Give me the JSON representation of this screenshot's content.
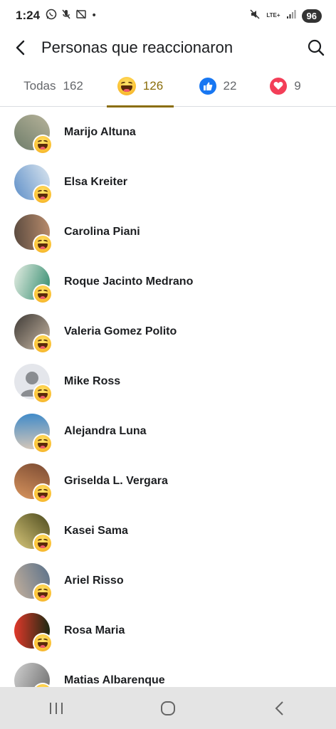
{
  "status_bar": {
    "time": "1:24",
    "dot": "•",
    "network": "LTE+",
    "battery": "96"
  },
  "header": {
    "title": "Personas que reaccionaron"
  },
  "tabs": [
    {
      "label": "Todas",
      "count": "162"
    },
    {
      "label": "",
      "count": "126",
      "icon": "haha-emoji-icon"
    },
    {
      "label": "",
      "count": "22",
      "icon": "like-icon"
    },
    {
      "label": "",
      "count": "9",
      "icon": "love-icon"
    }
  ],
  "people": [
    {
      "name": "Marijo Altuna",
      "reaction": "haha",
      "avatar_colors": [
        "#6e7d6a",
        "#b7b39a"
      ]
    },
    {
      "name": "Elsa Kreiter",
      "reaction": "haha",
      "avatar_colors": [
        "#5e8fc8",
        "#dbe6ef"
      ]
    },
    {
      "name": "Carolina Piani",
      "reaction": "haha",
      "avatar_colors": [
        "#5a4a3f",
        "#b98c6c"
      ]
    },
    {
      "name": "Roque Jacinto Medrano",
      "reaction": "haha",
      "avatar_colors": [
        "#e7eee4",
        "#2f8a6c"
      ]
    },
    {
      "name": "Valeria Gomez Polito",
      "reaction": "haha",
      "avatar_colors": [
        "#3e3a36",
        "#c9b8a4"
      ]
    },
    {
      "name": "Mike Ross",
      "reaction": "haha",
      "avatar_colors": [
        "#e4e6eb",
        "#8a8d91"
      ]
    },
    {
      "name": "Alejandra Luna",
      "reaction": "haha",
      "avatar_colors": [
        "#3f8ac9",
        "#d6c7b8"
      ]
    },
    {
      "name": "Griselda L. Vergara",
      "reaction": "haha",
      "avatar_colors": [
        "#7a4a32",
        "#d9955e"
      ]
    },
    {
      "name": "Kasei Sama",
      "reaction": "haha",
      "avatar_colors": [
        "#4c4a1e",
        "#d8c77a"
      ]
    },
    {
      "name": "Ariel Risso",
      "reaction": "haha",
      "avatar_colors": [
        "#58708a",
        "#c6b19c"
      ]
    },
    {
      "name": "Rosa Maria",
      "reaction": "haha",
      "avatar_colors": [
        "#1d2a12",
        "#e0382a"
      ]
    },
    {
      "name": "Matias Albarenque",
      "reaction": "haha",
      "avatar_colors": [
        "#6c6c6c",
        "#d0d0d0"
      ]
    }
  ],
  "colors": {
    "accent": "#8a6d0a",
    "like": "#1877f2",
    "love": "#f33e58"
  }
}
